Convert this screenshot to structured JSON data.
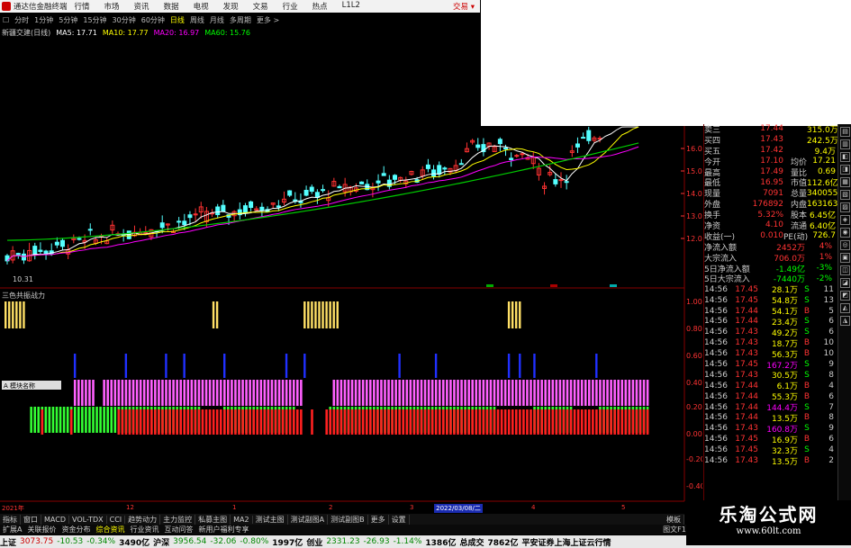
{
  "window": {
    "app_title": "通达信金融终端",
    "menus": [
      "行情",
      "市场",
      "资讯",
      "数据",
      "电视",
      "发现",
      "文易",
      "行业",
      "热点",
      "L1L2"
    ],
    "trade_label": "交易 ▾"
  },
  "toolbar": {
    "items": [
      "☐",
      "分时",
      "1分钟",
      "5分钟",
      "15分钟",
      "30分钟",
      "60分钟",
      "日线",
      "周线",
      "月线",
      "多周期",
      "更多 >"
    ],
    "active_index": 7
  },
  "ma_row": {
    "stock_label": "新疆交建(日线)",
    "ma5": "MA5: 17.71",
    "ma10": "MA10: 17.77",
    "ma20": "MA20: 16.97",
    "ma60": "MA60: 15.76",
    "colors": {
      "ma5": "#ffffff",
      "ma10": "#ffff00",
      "ma20": "#ff00ff",
      "ma60": "#00ff00"
    }
  },
  "price_axis": [
    "16.00",
    "15.00",
    "14.00",
    "13.00",
    "12.00"
  ],
  "low_marker": "10.31",
  "indicator": {
    "title": "三色共振战力",
    "axis": [
      "1.00",
      "0.80",
      "0.60",
      "0.40",
      "0.20",
      "0.00",
      "-0.20",
      "-0.40"
    ],
    "popup": "A 模块名称"
  },
  "quote": {
    "rows": [
      {
        "l": "卖三",
        "v1": "17.44",
        "l2": "",
        "v2": "315.0万"
      },
      {
        "l": "买四",
        "v1": "17.43",
        "l2": "",
        "v2": "242.5万"
      },
      {
        "l": "买五",
        "v1": "17.42",
        "l2": "",
        "v2": "9.4万"
      },
      {
        "l": "今开",
        "v1": "17.10",
        "l2": "均价",
        "v2": "17.21"
      },
      {
        "l": "最高",
        "v1": "17.49",
        "l2": "量比",
        "v2": "0.69"
      },
      {
        "l": "最低",
        "v1": "16.95",
        "l2": "市值",
        "v2": "112.6亿"
      },
      {
        "l": "现量",
        "v1": "7091",
        "l2": "总量",
        "v2": "340055"
      },
      {
        "l": "外盘",
        "v1": "176892",
        "l2": "内盘",
        "v2": "163163"
      },
      {
        "l": "换手",
        "v1": "5.32%",
        "l2": "股本",
        "v2": "6.45亿"
      },
      {
        "l": "净资",
        "v1": "4.10",
        "l2": "流通",
        "v2": "6.40亿"
      },
      {
        "l": "收益(一)",
        "v1": "0.010",
        "l2": "PE(动)",
        "v2": "726.7"
      }
    ],
    "fund": [
      {
        "label": "净流入额",
        "value": "2452万",
        "pct": "4%"
      },
      {
        "label": "大宗流入",
        "value": "706.0万",
        "pct": "1%"
      },
      {
        "label": "5日净流入额",
        "value": "-1.49亿",
        "pct": "-3%"
      },
      {
        "label": "5日大宗流入",
        "value": "-7440万",
        "pct": "-2%"
      }
    ],
    "ticks": [
      {
        "t": "14:56",
        "p": "17.45",
        "vol": "28.1万",
        "bs": "S",
        "n": "11"
      },
      {
        "t": "14:56",
        "p": "17.45",
        "vol": "54.8万",
        "bs": "S",
        "n": "13"
      },
      {
        "t": "14:56",
        "p": "17.44",
        "vol": "54.1万",
        "bs": "B",
        "n": "5"
      },
      {
        "t": "14:56",
        "p": "17.44",
        "vol": "23.4万",
        "bs": "S",
        "n": "6"
      },
      {
        "t": "14:56",
        "p": "17.43",
        "vol": "49.2万",
        "bs": "S",
        "n": "6"
      },
      {
        "t": "14:56",
        "p": "17.43",
        "vol": "18.7万",
        "bs": "B",
        "n": "10"
      },
      {
        "t": "14:56",
        "p": "17.43",
        "vol": "56.3万",
        "bs": "B",
        "n": "10"
      },
      {
        "t": "14:56",
        "p": "17.45",
        "vol": "167.2万",
        "bs": "S",
        "n": "9"
      },
      {
        "t": "14:56",
        "p": "17.43",
        "vol": "30.5万",
        "bs": "S",
        "n": "8"
      },
      {
        "t": "14:56",
        "p": "17.44",
        "vol": "6.1万",
        "bs": "B",
        "n": "4"
      },
      {
        "t": "14:56",
        "p": "17.44",
        "vol": "55.3万",
        "bs": "B",
        "n": "6"
      },
      {
        "t": "14:56",
        "p": "17.44",
        "vol": "144.4万",
        "bs": "S",
        "n": "7"
      },
      {
        "t": "14:56",
        "p": "17.44",
        "vol": "13.5万",
        "bs": "B",
        "n": "8"
      },
      {
        "t": "14:56",
        "p": "17.43",
        "vol": "160.8万",
        "bs": "S",
        "n": "9"
      },
      {
        "t": "14:56",
        "p": "17.45",
        "vol": "16.9万",
        "bs": "B",
        "n": "6"
      },
      {
        "t": "14:56",
        "p": "17.45",
        "vol": "32.3万",
        "bs": "S",
        "n": "4"
      },
      {
        "t": "14:56",
        "p": "17.43",
        "vol": "13.5万",
        "bs": "B",
        "n": "2"
      }
    ]
  },
  "date_axis": {
    "labels": [
      "2021年",
      "12",
      "1",
      "2",
      "3",
      "4",
      "5"
    ],
    "highlight": "2022/03/08/二"
  },
  "bottom_tabs": [
    "指标",
    "窗口",
    "MACD",
    "VOL-TDX",
    "CCI",
    "趋势动力",
    "主力监控",
    "私募主图",
    "MA2",
    "测试主图",
    "测试副图A",
    "测试副图B",
    "更多",
    "设置"
  ],
  "bottom_right_tab": "模板",
  "bottom_tabs2": [
    "扩展A",
    "关联报价",
    "资金分布",
    "综合资讯",
    "行业资讯",
    "互动问答",
    "新用户福利专享"
  ],
  "bottom_tabs2_hl": 3,
  "bottom_tabs2_right": "图文F10 ▣",
  "status": {
    "items": [
      {
        "c": "b",
        "t": "上证"
      },
      {
        "c": "up",
        "t": "3073.75"
      },
      {
        "c": "dn",
        "t": "-10.53"
      },
      {
        "c": "dn",
        "t": "-0.34%"
      },
      {
        "c": "b",
        "t": "3490亿"
      },
      {
        "c": "b",
        "t": "沪深"
      },
      {
        "c": "dn",
        "t": "3956.54"
      },
      {
        "c": "dn",
        "t": "-32.06"
      },
      {
        "c": "dn",
        "t": "-0.80%"
      },
      {
        "c": "b",
        "t": "1997亿"
      },
      {
        "c": "b",
        "t": "创业"
      },
      {
        "c": "dn",
        "t": "2331.23"
      },
      {
        "c": "dn",
        "t": "-26.93"
      },
      {
        "c": "dn",
        "t": "-1.14%"
      },
      {
        "c": "b",
        "t": "1386亿"
      },
      {
        "c": "b",
        "t": "总成交"
      },
      {
        "c": "b",
        "t": "7862亿"
      },
      {
        "c": "b",
        "t": "平安证券上海上证云行情"
      }
    ]
  },
  "watermark": {
    "big": "乐淘公式网",
    "url": "www.60lt.com"
  }
}
